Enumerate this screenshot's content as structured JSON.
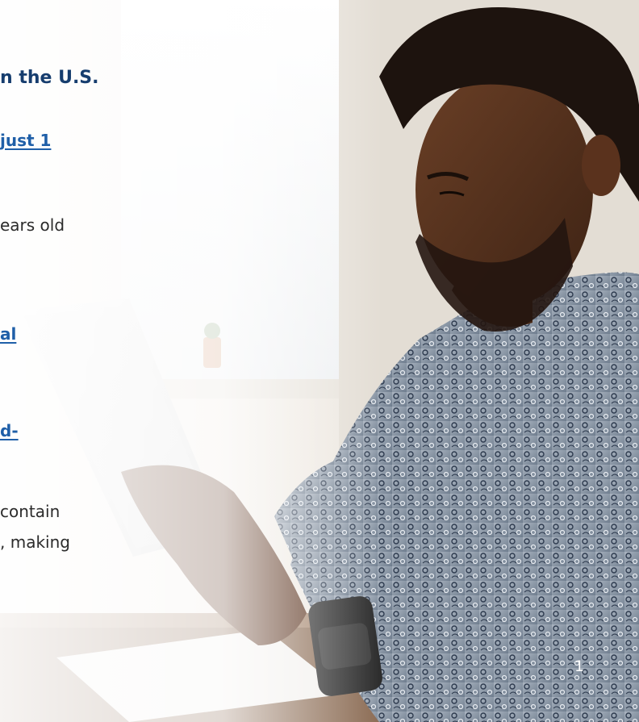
{
  "slide": {
    "heading": "n the U.S.",
    "fragments": [
      {
        "text": "just 1 ",
        "style": "link"
      },
      {
        "text": "ears old",
        "style": "body"
      },
      {
        "text": "al ",
        "style": "link"
      },
      {
        "text": "d-",
        "style": "link"
      },
      {
        "text": "contain",
        "style": "body"
      },
      {
        "text": ", making",
        "style": "body"
      }
    ],
    "page_number": "1"
  },
  "colors": {
    "heading": "#163d6e",
    "link": "#1f5fa8",
    "body": "#2b2b2b",
    "page_number": "#ffffff"
  },
  "image": {
    "description_icon": "man-with-tablet-photo"
  }
}
